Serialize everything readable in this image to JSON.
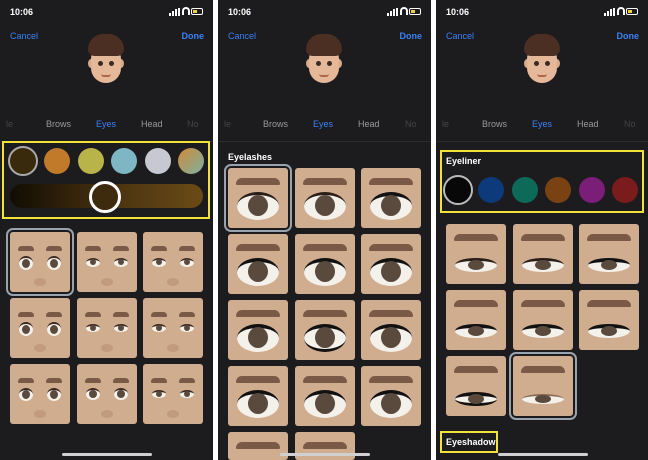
{
  "status": {
    "time": "10:06"
  },
  "nav": {
    "cancel": "Cancel",
    "done": "Done"
  },
  "panel1": {
    "tabs": [
      "le",
      "Brows",
      "Eyes",
      "Head",
      "No"
    ],
    "swatches": [
      "#3a2a0c",
      "#c07a2a",
      "#b8b44a",
      "#7eb7c3",
      "#c8c8d2",
      "#c9a66b"
    ]
  },
  "panel2": {
    "tabs": [
      "le",
      "Brows",
      "Eyes",
      "Head",
      "No"
    ],
    "section": "Eyelashes"
  },
  "panel3": {
    "tabs": [
      "le",
      "Brows",
      "Eyes",
      "Head",
      "No"
    ],
    "section": "Eyeliner",
    "section2": "Eyeshadow",
    "swatches": [
      "#080808",
      "#0d3a7a",
      "#0d6a58",
      "#7a4212",
      "#7a1e78",
      "#7a1c1c"
    ]
  },
  "colors": {
    "accent": "#3b82f6",
    "highlight": "#f0e236",
    "background": "#1c1c1e"
  }
}
